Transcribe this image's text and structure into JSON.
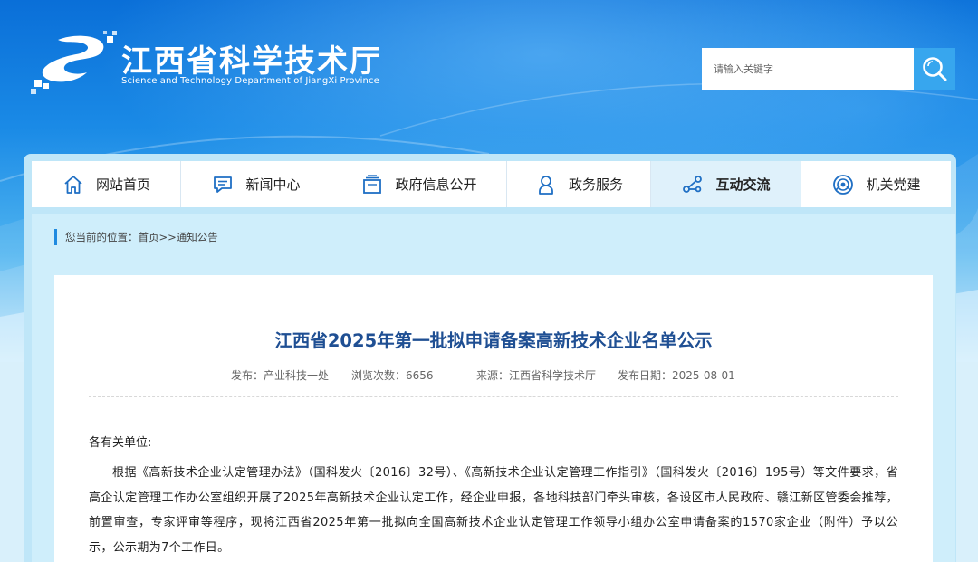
{
  "header": {
    "title_cn": "江西省科学技术厅",
    "title_en": "Science and Technology Department of JiangXi Province",
    "search_placeholder": "请输入关键字"
  },
  "nav": {
    "items": [
      {
        "label": "网站首页",
        "icon": "home-icon"
      },
      {
        "label": "新闻中心",
        "icon": "chat-bubble-icon"
      },
      {
        "label": "政府信息公开",
        "icon": "document-stack-icon"
      },
      {
        "label": "政务服务",
        "icon": "person-icon"
      },
      {
        "label": "互动交流",
        "icon": "connection-icon",
        "active": true
      },
      {
        "label": "机关党建",
        "icon": "emblem-icon"
      }
    ]
  },
  "breadcrumb": {
    "prefix": "您当前的位置：",
    "home": "首页",
    "sep": ">>",
    "current": "通知公告"
  },
  "article": {
    "title": "江西省2025年第一批拟申请备案高新技术企业名单公示",
    "meta_publisher": "发布：产业科技一处",
    "meta_views": "浏览次数：6656",
    "meta_source": "来源：江西省科学技术厅",
    "meta_date": "发布日期：2025-08-01",
    "salutation": "各有关单位:",
    "paragraph": "根据《高新技术企业认定管理办法》（国科发火〔2016〕32号）、《高新技术企业认定管理工作指引》（国科发火〔2016〕195号）等文件要求，省高企认定管理工作办公室组织开展了2025年高新技术企业认定工作，经企业申报，各地科技部门牵头审核，各设区市人民政府、赣江新区管委会推荐，前置审查，专家评审等程序，现将江西省2025年第一批拟向全国高新技术企业认定管理工作领导小组办公室申请备案的1570家企业（附件）予以公示，公示期为7个工作日。"
  },
  "colors": {
    "brand_blue": "#0a6fd8",
    "title_blue": "#1f4f93",
    "search_button": "#37a6ee"
  }
}
